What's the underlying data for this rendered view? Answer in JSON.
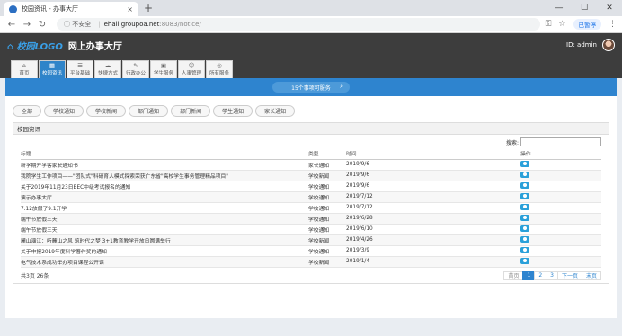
{
  "browser": {
    "tab_title": "校园资讯 - 办事大厅",
    "tab_close": "×",
    "new_tab": "+",
    "win_min": "—",
    "win_max": "☐",
    "win_close": "✕",
    "back": "←",
    "forward": "→",
    "reload": "↻",
    "info_label": "ⓘ 不安全",
    "url_host": "ehall.groupoa.net",
    "url_path": ":8083/notice/",
    "key_icon": "⚿",
    "star_icon": "☆",
    "paused_label": "已暂停",
    "menu_icon": "⋮"
  },
  "app": {
    "logo": "⌂ 校园LOGO",
    "title": "网上办事大厅",
    "user_id": "ID: admin"
  },
  "modules": [
    {
      "icon": "⌂",
      "label": "首页"
    },
    {
      "icon": "▦",
      "label": "校园资讯",
      "active": true
    },
    {
      "icon": "☰",
      "label": "平台基础"
    },
    {
      "icon": "☁",
      "label": "快捷方式"
    },
    {
      "icon": "✎",
      "label": "行政办公"
    },
    {
      "icon": "▣",
      "label": "学生服务"
    },
    {
      "icon": "☺",
      "label": "人事管理"
    },
    {
      "icon": "◎",
      "label": "所有服务"
    }
  ],
  "search_band": {
    "placeholder": "15个事项可服务",
    "icon": "⌕"
  },
  "filters": [
    "全部",
    "学校通知",
    "学校新闻",
    "部门通知",
    "部门新闻",
    "学生通知",
    "家长通知"
  ],
  "panel": {
    "title": "校园资讯",
    "search_label": "搜索:",
    "search_value": ""
  },
  "table": {
    "headers": [
      "标题",
      "类型",
      "时间",
      "操作"
    ],
    "rows": [
      {
        "title": "新学期开学客家长通知书",
        "type": "家长通知",
        "date": "2019/9/6"
      },
      {
        "title": "我院学生工作项目——\"团队式\"科研育人模式探索荣获广东省\"高校学生事务管理精品项目\"",
        "type": "学校新闻",
        "date": "2019/9/6"
      },
      {
        "title": "关于2019年11月23日BEC中级考试报名的通知",
        "type": "学校通知",
        "date": "2019/9/6"
      },
      {
        "title": "演示办事大厅",
        "type": "学校通知",
        "date": "2019/7/12"
      },
      {
        "title": "7.12放假了9.1开学",
        "type": "学校通知",
        "date": "2019/7/12"
      },
      {
        "title": "端午节放假三天",
        "type": "学校通知",
        "date": "2019/6/28"
      },
      {
        "title": "端午节放假三天",
        "type": "学校通知",
        "date": "2019/6/10"
      },
      {
        "title": "麓山演江：听麓山之风 筑时代之梦 3+1教育教学开放日圆满举行",
        "type": "学校新闻",
        "date": "2019/4/26"
      },
      {
        "title": "关于申报2019年度科学著作奖的通知",
        "type": "学校通知",
        "date": "2019/3/9"
      },
      {
        "title": "电气技术系成功举办项目课程公开课",
        "type": "学校新闻",
        "date": "2019/1/4"
      }
    ]
  },
  "footer": {
    "summary": "共3页 26条",
    "pages": [
      "首页",
      "1",
      "2",
      "3",
      "下一页",
      "末页"
    ]
  }
}
